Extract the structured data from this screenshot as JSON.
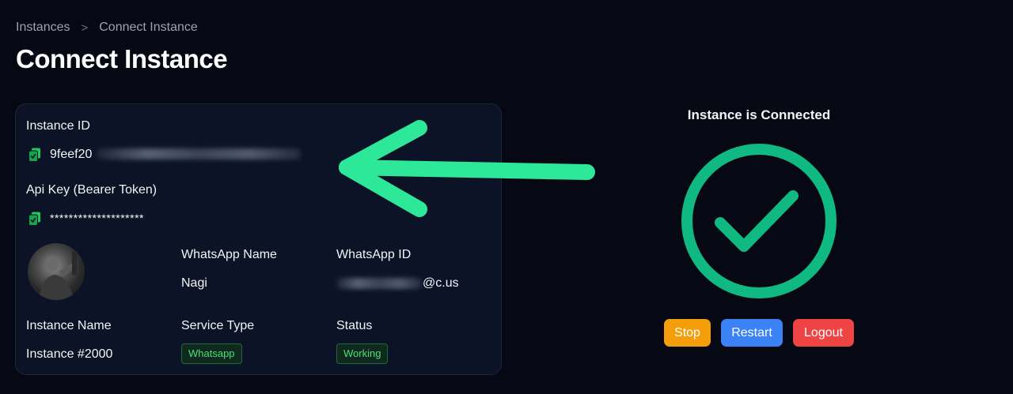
{
  "breadcrumb": {
    "parent": "Instances",
    "separator": ">",
    "current": "Connect Instance"
  },
  "page": {
    "title": "Connect Instance"
  },
  "card": {
    "instance_id_label": "Instance ID",
    "instance_id_value": "9feef20",
    "api_key_label": "Api Key (Bearer Token)",
    "api_key_value": "********************",
    "whatsapp_name_label": "WhatsApp Name",
    "whatsapp_name_value": "Nagi",
    "whatsapp_id_label": "WhatsApp ID",
    "whatsapp_id_suffix": "@c.us",
    "instance_name_label": "Instance Name",
    "instance_name_value": "Instance #2000",
    "service_type_label": "Service Type",
    "service_type_value": "Whatsapp",
    "status_label": "Status",
    "status_value": "Working"
  },
  "connection": {
    "status_text": "Instance is Connected",
    "check_color": "#10b981"
  },
  "actions": {
    "stop_label": "Stop",
    "restart_label": "Restart",
    "logout_label": "Logout",
    "stop_color": "#f59e0b",
    "restart_color": "#3b82f6",
    "logout_color": "#ef4444"
  },
  "annotation": {
    "arrow_color": "#2ee89a"
  },
  "icons": {
    "copy": "copy-icon",
    "chevron": "chevron-right-icon",
    "check": "check-circle-icon"
  }
}
